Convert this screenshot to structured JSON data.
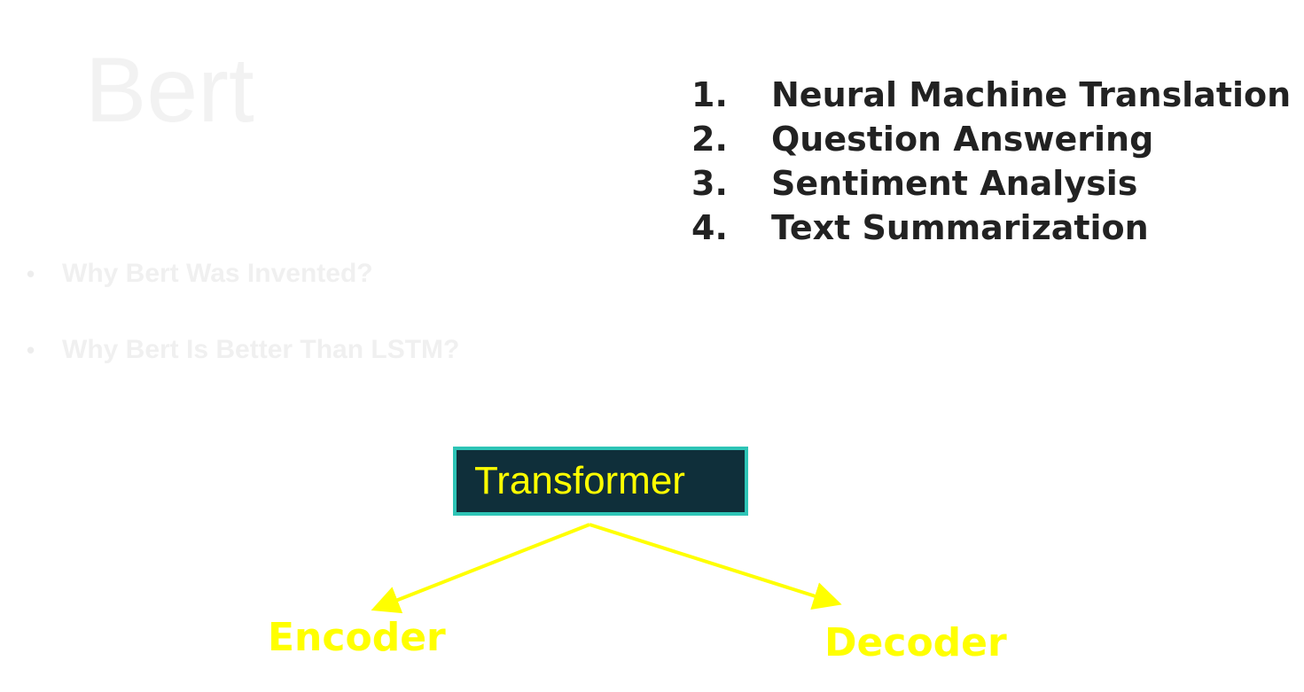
{
  "title": "Bert",
  "bullets": [
    "Why Bert Was Invented?",
    "Why Bert Is Better Than LSTM?"
  ],
  "bullet_symbol": "•",
  "applications": [
    {
      "num": "1.",
      "label": "Neural Machine Translation"
    },
    {
      "num": "2.",
      "label": "Question Answering"
    },
    {
      "num": "3.",
      "label": "Sentiment Analysis"
    },
    {
      "num": "4.",
      "label": "Text Summarization"
    }
  ],
  "diagram": {
    "root": "Transformer",
    "left_child": "Encoder",
    "right_child": "Decoder",
    "colors": {
      "box_fill": "#0f2f3a",
      "box_border": "#2ec4b6",
      "label": "#ffff00",
      "arrow": "#ffff00"
    }
  }
}
